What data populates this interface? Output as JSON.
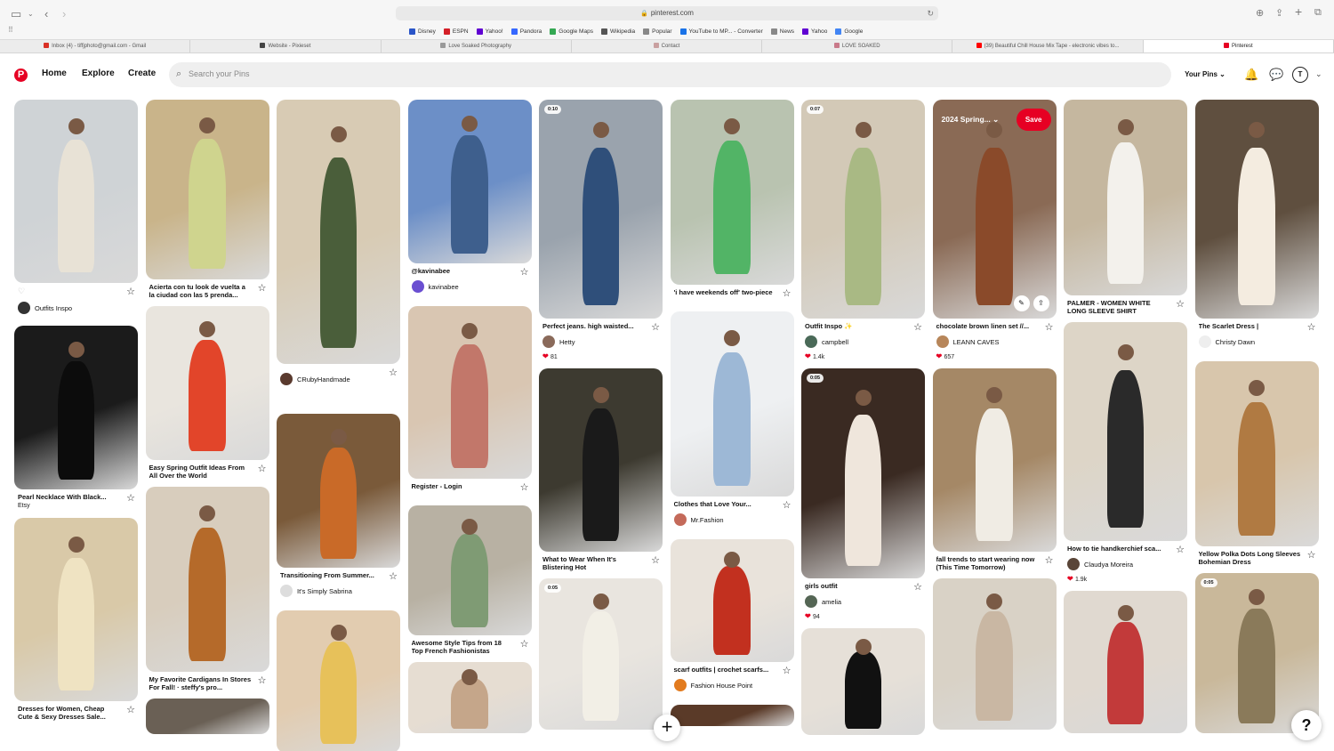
{
  "browser": {
    "url": "pinterest.com",
    "bookmarks": [
      {
        "label": "Disney",
        "color": "#2a55c8"
      },
      {
        "label": "ESPN",
        "color": "#d41f27"
      },
      {
        "label": "Yahoo!",
        "color": "#6001d2"
      },
      {
        "label": "Pandora",
        "color": "#3668ff"
      },
      {
        "label": "Google Maps",
        "color": "#34a853"
      },
      {
        "label": "Wikipedia",
        "color": "#555555"
      },
      {
        "label": "Popular",
        "color": "#888888"
      },
      {
        "label": "YouTube to MP... - Converter",
        "color": "#1a73e8"
      },
      {
        "label": "News",
        "color": "#888888"
      },
      {
        "label": "Yahoo",
        "color": "#6001d2"
      },
      {
        "label": "Google",
        "color": "#4285f4"
      }
    ],
    "tabs": [
      {
        "label": "Inbox (4) - tiffjphoto@gmail.com - Gmail",
        "color": "#d93025",
        "active": false
      },
      {
        "label": "Website - Pixieset",
        "color": "#444444",
        "active": false
      },
      {
        "label": "Love Soaked Photography",
        "color": "#999999",
        "active": false
      },
      {
        "label": "Contact",
        "color": "#c9a0a0",
        "active": false
      },
      {
        "label": "LOVE SOAKED",
        "color": "#c97a8a",
        "active": false
      },
      {
        "label": "(39) Beautiful Chill House Mix Tape - electronic vibes to...",
        "color": "#ff0000",
        "active": false
      },
      {
        "label": "Pinterest",
        "color": "#e60023",
        "active": true
      }
    ]
  },
  "header": {
    "logo": "P",
    "nav": [
      "Home",
      "Explore",
      "Create"
    ],
    "search_placeholder": "Search your Pins",
    "your_pins": "Your Pins",
    "avatar_initial": "T"
  },
  "columns": [
    [
      {
        "h": 206,
        "bg": "#cfd3d6",
        "fig": "#e8e2d6",
        "title": "",
        "heart": "♡",
        "user": "Outfits Inspo",
        "av": "#333333"
      },
      {
        "h": 184,
        "bg": "#1b1b1b",
        "fig": "#0c0c0c",
        "title": "Pearl Necklace With Black...",
        "sub": "Etsy"
      },
      {
        "h": 206,
        "bg": "#d9c9a8",
        "fig": "#efe3c2",
        "title": "Dresses for Women, Cheap Cute & Sexy Dresses Sale..."
      }
    ],
    [
      {
        "h": 202,
        "bg": "#c9b48a",
        "fig": "#cfd48e",
        "title": "Acierta con tu look de vuelta a la ciudad con las 5 prenda..."
      },
      {
        "h": 173,
        "bg": "#e9e5de",
        "fig": "#e2452a",
        "title": "Easy Spring Outfit Ideas From All Over the World"
      },
      {
        "h": 208,
        "bg": "#d8cdbd",
        "fig": "#b56a2a",
        "title": "My Favorite Cardigans In Stores For Fall! · steffy's pro..."
      },
      {
        "h": 40,
        "bg": "#6a6055",
        "fig": "#3b3128",
        "title": ""
      }
    ],
    [
      {
        "h": 297,
        "bg": "#d8cbb4",
        "fig": "#4a5e3a",
        "title": "",
        "user": "CRubyHandmade",
        "av": "#5a3a2e"
      },
      {
        "h": 173,
        "bg": "#7a5a3a",
        "fig": "#c96a28",
        "title": "Transitioning From Summer...",
        "user": "It's Simply Sabrina",
        "av": "#dddddd"
      },
      {
        "h": 160,
        "bg": "#e2ccb0",
        "fig": "#e7c15a",
        "title": ""
      }
    ],
    [
      {
        "h": 184,
        "bg": "#6c8fc7",
        "fig": "#3e5f8d",
        "title": "@kavinabee",
        "user": "kavinabee",
        "av": "#6a4fd1"
      },
      {
        "h": 194,
        "bg": "#d9c6b2",
        "fig": "#c2776a",
        "title": "Register - Login"
      },
      {
        "h": 146,
        "bg": "#b8b1a3",
        "fig": "#7f9b74",
        "title": "Awesome Style Tips from 18 Top French Fashionistas"
      },
      {
        "h": 80,
        "bg": "#e6ddd2",
        "fig": "#c5a68a",
        "title": ""
      }
    ],
    [
      {
        "h": 246,
        "bg": "#9aa3ad",
        "fig": "#2f4f7a",
        "title": "Perfect jeans. high waisted...",
        "video": "0:10",
        "user": "Hetty",
        "av": "#8a6a5a",
        "likes": "81"
      },
      {
        "h": 206,
        "bg": "#3d3a30",
        "fig": "#1a1a1a",
        "title": "What to Wear When It's Blistering Hot"
      },
      {
        "h": 170,
        "bg": "#e9e5df",
        "fig": "#f2efe6",
        "title": "",
        "video": "0:05"
      }
    ],
    [
      {
        "h": 208,
        "bg": "#b9c3b0",
        "fig": "#52b466",
        "title": "'i have weekends off' two-piece"
      },
      {
        "h": 208,
        "bg": "#eef0f2",
        "fig": "#9db8d6",
        "title": "Clothes that Love Your...",
        "user": "Mr.Fashion",
        "av": "#c46a5a"
      },
      {
        "h": 138,
        "bg": "#e9e3db",
        "fig": "#c2301f",
        "title": "scarf outfits | crochet scarfs...",
        "user": "Fashion House Point",
        "av": "#e27b1f"
      },
      {
        "h": 24,
        "bg": "#5a3a28",
        "fig": "#3a2418",
        "title": ""
      }
    ],
    [
      {
        "h": 246,
        "bg": "#d3c9b7",
        "fig": "#a9b984",
        "title": "Outfit Inspo ✨",
        "video": "0:07",
        "user": "campbell",
        "av": "#4a6a58",
        "likes": "1.4k"
      },
      {
        "h": 236,
        "bg": "#3a2a22",
        "fig": "#efe6dc",
        "title": "girls outfit",
        "video": "0:05",
        "user": "amelia",
        "av": "#556655",
        "likes": "94"
      },
      {
        "h": 120,
        "bg": "#e6e0d8",
        "fig": "#111111",
        "title": ""
      }
    ],
    [
      {
        "h": 246,
        "bg": "#8a6a55",
        "fig": "#8a4a2a",
        "title": "chocolate brown linen set //...",
        "user": "LEANN CAVES",
        "av": "#b7865a",
        "likes": "657",
        "board": "2024 Spring...",
        "save": "Save"
      },
      {
        "h": 206,
        "bg": "#a58866",
        "fig": "#f0ece4",
        "title": "fall trends to start wearing now (This Time Tomorrow)"
      },
      {
        "h": 170,
        "bg": "#d9d2c6",
        "fig": "#c9b7a3",
        "title": ""
      }
    ],
    [
      {
        "h": 220,
        "bg": "#c5b79f",
        "fig": "#f3f1ec",
        "title": "PALMER - WOMEN WHITE LONG SLEEVE SHIRT"
      },
      {
        "h": 246,
        "bg": "#ddd5c7",
        "fig": "#2a2a2a",
        "title": "How to tie handkerchief sca...",
        "user": "Claudya Moreira",
        "av": "#5a4538",
        "likes": "1.9k"
      },
      {
        "h": 160,
        "bg": "#e0d9d0",
        "fig": "#c23a3a",
        "title": ""
      }
    ],
    [
      {
        "h": 246,
        "bg": "#5f4f3f",
        "fig": "#f4ece0",
        "title": "The Scarlet Dress |",
        "user": "Christy Dawn",
        "av": "#eeeeee"
      },
      {
        "h": 208,
        "bg": "#d8c6ac",
        "fig": "#b07a42",
        "title": "Yellow Polka Dots Long Sleeves Bohemian Dress"
      },
      {
        "h": 180,
        "bg": "#c9b89a",
        "fig": "#8a7a5a",
        "title": "",
        "video": "0:05"
      }
    ]
  ],
  "fab": "+",
  "help": "?"
}
